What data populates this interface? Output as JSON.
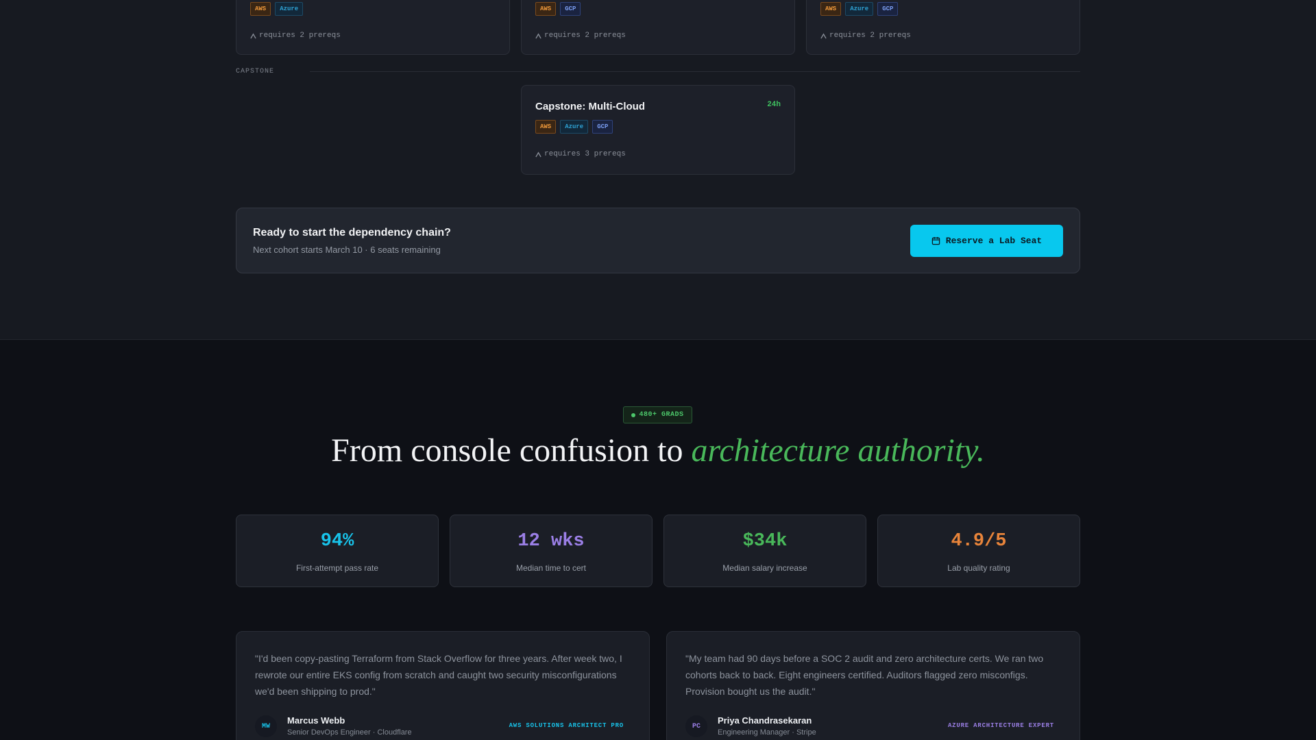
{
  "path_cards": [
    {
      "tags": [
        "AWS",
        "Azure"
      ],
      "prereqs": "requires 2 prereqs"
    },
    {
      "tags": [
        "AWS",
        "GCP"
      ],
      "prereqs": "requires 2 prereqs"
    },
    {
      "tags": [
        "AWS",
        "Azure",
        "GCP"
      ],
      "prereqs": "requires 2 prereqs"
    }
  ],
  "capstone_section": {
    "label": "CAPSTONE",
    "card": {
      "title": "Capstone: Multi-Cloud",
      "hours": "24h",
      "tags": [
        "AWS",
        "Azure",
        "GCP"
      ],
      "prereqs": "requires 3 prereqs"
    }
  },
  "cta": {
    "title": "Ready to start the dependency chain?",
    "subtitle": "Next cohort starts March 10 · 6 seats remaining",
    "button_label": "Reserve a Lab Seat",
    "button_icon": "calendar-icon"
  },
  "outcomes": {
    "badge": "480+ GRADS",
    "headline_plain": "From console confusion to ",
    "headline_accent": "architecture authority.",
    "stats": [
      {
        "value": "94%",
        "label": "First-attempt pass rate",
        "color": "#18c3ea"
      },
      {
        "value": "12 wks",
        "label": "Median time to cert",
        "color": "#9b7fe6"
      },
      {
        "value": "$34k",
        "label": "Median salary increase",
        "color": "#49b85a"
      },
      {
        "value": "4.9/5",
        "label": "Lab quality rating",
        "color": "#e8843a"
      }
    ]
  },
  "testimonials": [
    {
      "quote": "\"I'd been copy-pasting Terraform from Stack Overflow for three years. After week two, I rewrote our entire EKS config from scratch and caught two security misconfigurations we'd been shipping to prod.\"",
      "initials": "MW",
      "name": "Marcus Webb",
      "role": "Senior DevOps Engineer · Cloudflare",
      "cert": "AWS SOLUTIONS ARCHITECT PRO",
      "accent": "#18c3ea"
    },
    {
      "quote": "\"My team had 90 days before a SOC 2 audit and zero architecture certs. We ran two cohorts back to back. Eight engineers certified. Auditors flagged zero misconfigs. Provision bought us the audit.\"",
      "initials": "PC",
      "name": "Priya Chandrasekaran",
      "role": "Engineering Manager · Stripe",
      "cert": "AZURE ARCHITECTURE EXPERT",
      "accent": "#9b7fe6"
    }
  ]
}
